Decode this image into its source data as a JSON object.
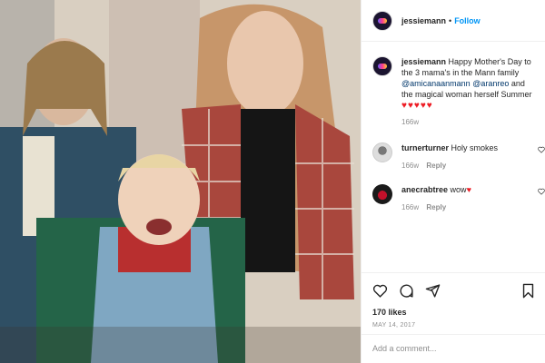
{
  "post": {
    "username": "jessiemann",
    "separator": "•",
    "follow_label": "Follow"
  },
  "caption": {
    "username": "jessiemann",
    "text_1": "Happy Mother's Day to the 3 mama's in the Mann family",
    "mention_1": "@amicanaanmann",
    "mention_2": "@aranreo",
    "text_2": "and the magical woman herself Summer",
    "hearts": "♥♥♥♥♥",
    "age": "166w"
  },
  "comments": [
    {
      "username": "turnerturner",
      "text": "Holy smokes",
      "age": "166w",
      "reply_label": "Reply"
    },
    {
      "username": "anecrabtree",
      "text": "wow",
      "heart": "♥",
      "age": "166w",
      "reply_label": "Reply"
    }
  ],
  "actions": {
    "likes": "170 likes",
    "date": "MAY 14, 2017"
  },
  "add_comment": {
    "placeholder": "Add a comment..."
  },
  "icons": [
    "heart-icon",
    "comment-icon",
    "share-icon",
    "bookmark-icon"
  ],
  "colors": {
    "follow": "#0095f6",
    "mention": "#00376b",
    "heart": "#ed1c24",
    "muted": "#8e8e8e"
  }
}
